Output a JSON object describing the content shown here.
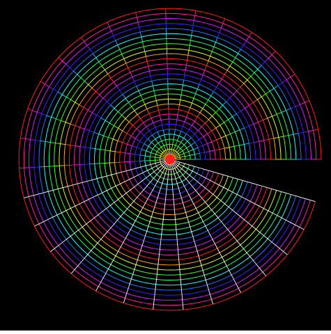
{
  "chart_data": {
    "type": "polar-grid",
    "title": "",
    "xlabel": "",
    "ylabel": "",
    "xlim": [
      -3.05,
      3.05
    ],
    "ylim": [
      -3.05,
      3.05
    ],
    "x_ticks": [
      "-3",
      "-2",
      "-1",
      "0",
      "1",
      "2",
      "3"
    ],
    "y_ticks": [
      "3",
      "2",
      "1",
      "0",
      "-1",
      "-2",
      "-3"
    ],
    "x_tick_values": [
      -3,
      -2,
      -1,
      0,
      1,
      2,
      3
    ],
    "y_tick_values": [
      3,
      2,
      1,
      0,
      -1,
      -2,
      -3
    ],
    "r_min": 0.1,
    "r_max": 3.0,
    "r_step": 0.1,
    "theta_start_rad": 0,
    "theta_end_rad": 6.0,
    "theta_steps": 30,
    "background": "#000000",
    "spoke_color": "#ffffff",
    "hue_cycle_start": 0.0,
    "hue_cycle_rate": 0.25,
    "grid": false,
    "legend": "none"
  }
}
